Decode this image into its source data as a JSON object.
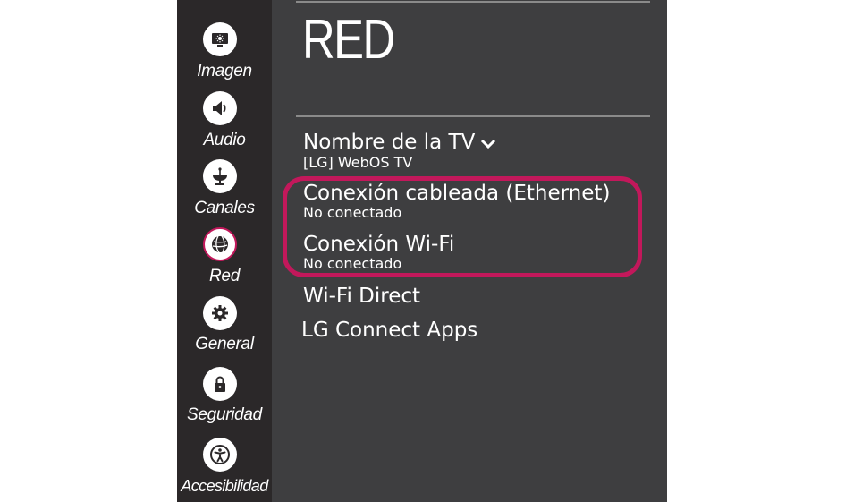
{
  "sidebar": {
    "items": [
      {
        "label": "Imagen",
        "icon": "picture-icon"
      },
      {
        "label": "Audio",
        "icon": "speaker-icon"
      },
      {
        "label": "Canales",
        "icon": "antenna-icon"
      },
      {
        "label": "Red",
        "icon": "network-globe-icon",
        "active": true
      },
      {
        "label": "General",
        "icon": "gear-icon"
      },
      {
        "label": "Seguridad",
        "icon": "lock-icon"
      },
      {
        "label": "Accesibilidad",
        "icon": "accessibility-icon"
      }
    ]
  },
  "page": {
    "title": "RED"
  },
  "menu": {
    "tv_name": {
      "label": "Nombre de la TV",
      "value": "[LG] WebOS TV"
    },
    "ethernet": {
      "label": "Conexión cableada (Ethernet)",
      "status": "No conectado"
    },
    "wifi": {
      "label": "Conexión Wi-Fi",
      "status": "No conectado"
    },
    "wifi_direct": {
      "label": "Wi-Fi Direct"
    },
    "lg_connect": {
      "label": "LG Connect Apps"
    }
  },
  "colors": {
    "highlight": "#c2185b",
    "background": "#3e3e40",
    "sidebar": "#2b2829"
  }
}
